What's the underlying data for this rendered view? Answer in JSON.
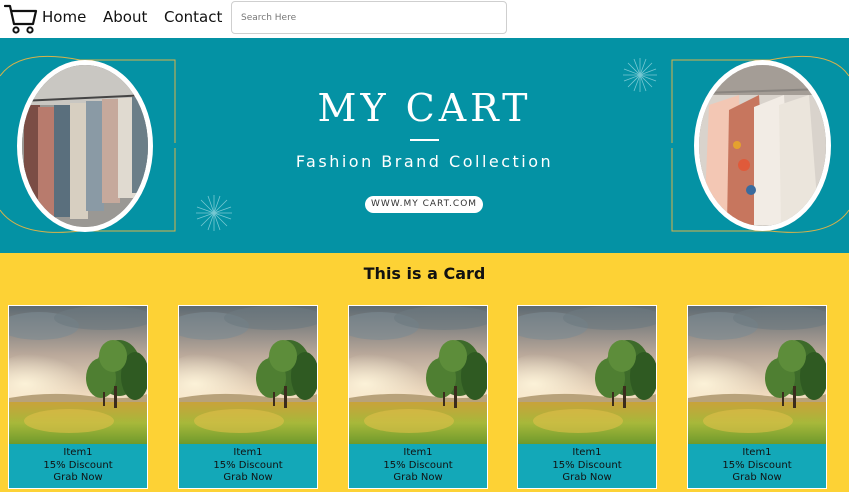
{
  "navbar": {
    "links": [
      "Home",
      "About",
      "Contact"
    ],
    "search_placeholder": "Search Here",
    "search_value": ""
  },
  "banner": {
    "title": "MY CART",
    "subtitle": "Fashion Brand Collection",
    "url": "WWW.MY CART.COM"
  },
  "cards_section": {
    "title": "This is a Card",
    "cards": [
      {
        "name": "Item1",
        "discount": "15% Discount",
        "cta": "Grab Now"
      },
      {
        "name": "Item1",
        "discount": "15% Discount",
        "cta": "Grab Now"
      },
      {
        "name": "Item1",
        "discount": "15% Discount",
        "cta": "Grab Now"
      },
      {
        "name": "Item1",
        "discount": "15% Discount",
        "cta": "Grab Now"
      },
      {
        "name": "Item1",
        "discount": "15% Discount",
        "cta": "Grab Now"
      }
    ]
  },
  "colors": {
    "banner_bg": "#0492a4",
    "section_bg": "#fdd235",
    "card_body_bg": "#13a8b8"
  },
  "icons": {
    "logo": "shopping-cart-icon"
  }
}
